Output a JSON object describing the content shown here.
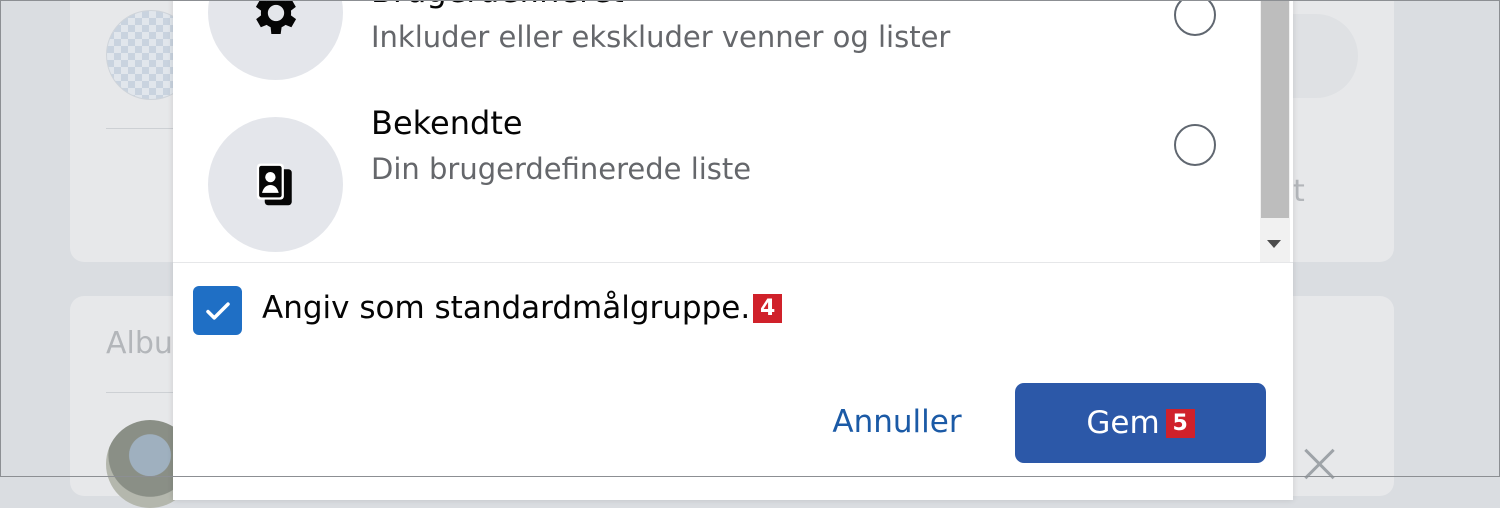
{
  "background": {
    "albums_label": "Albu",
    "right_fragment": "t"
  },
  "dialog": {
    "options": [
      {
        "title": "Brugerdefineret",
        "subtitle": "Inkluder eller ekskluder venner og lister",
        "icon": "gear-icon",
        "selected": false
      },
      {
        "title": "Bekendte",
        "subtitle": "Din brugerdefinerede liste",
        "icon": "contact-cards-icon",
        "selected": false
      }
    ],
    "default_audience": {
      "label": "Angiv som standardmålgruppe.",
      "checked": true,
      "badge": "4"
    },
    "buttons": {
      "cancel": "Annuller",
      "save": "Gem",
      "save_badge": "5"
    }
  },
  "colors": {
    "primary_button": "#2c58a8",
    "link": "#1b5aa6",
    "checkbox": "#1f6fc5",
    "badge": "#d0212a"
  }
}
